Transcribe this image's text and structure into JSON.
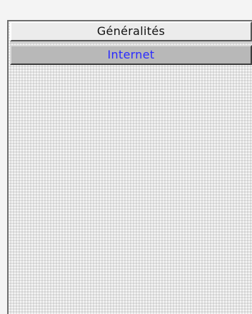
{
  "panel": {
    "tabs": [
      {
        "label": "Généralités",
        "selected": false
      },
      {
        "label": "Internet",
        "selected": true,
        "color": "#2a2aff"
      }
    ]
  }
}
